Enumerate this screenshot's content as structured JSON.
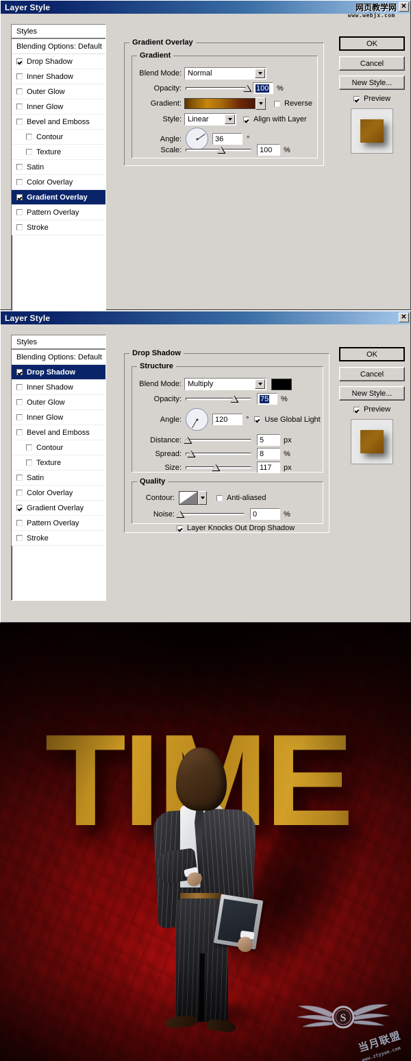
{
  "watermark_top": {
    "cn": "网页教学网",
    "url": "www.webjx.com"
  },
  "dialog1": {
    "title": "Layer Style",
    "close_label": "✕",
    "styles_panel": {
      "header": "Styles",
      "blending_options": "Blending Options: Default",
      "items": [
        {
          "label": "Drop Shadow",
          "checked": true,
          "indent": false,
          "selected": false
        },
        {
          "label": "Inner Shadow",
          "checked": false,
          "indent": false,
          "selected": false
        },
        {
          "label": "Outer Glow",
          "checked": false,
          "indent": false,
          "selected": false
        },
        {
          "label": "Inner Glow",
          "checked": false,
          "indent": false,
          "selected": false
        },
        {
          "label": "Bevel and Emboss",
          "checked": false,
          "indent": false,
          "selected": false
        },
        {
          "label": "Contour",
          "checked": false,
          "indent": true,
          "selected": false
        },
        {
          "label": "Texture",
          "checked": false,
          "indent": true,
          "selected": false
        },
        {
          "label": "Satin",
          "checked": false,
          "indent": false,
          "selected": false
        },
        {
          "label": "Color Overlay",
          "checked": false,
          "indent": false,
          "selected": false
        },
        {
          "label": "Gradient Overlay",
          "checked": true,
          "indent": false,
          "selected": true
        },
        {
          "label": "Pattern Overlay",
          "checked": false,
          "indent": false,
          "selected": false
        },
        {
          "label": "Stroke",
          "checked": false,
          "indent": false,
          "selected": false
        }
      ]
    },
    "panel": {
      "group_title": "Gradient Overlay",
      "section_title": "Gradient",
      "blend_mode_label": "Blend Mode:",
      "blend_mode_value": "Normal",
      "opacity_label": "Opacity:",
      "opacity_value": "100",
      "opacity_unit": "%",
      "gradient_label": "Gradient:",
      "reverse_label": "Reverse",
      "reverse_checked": false,
      "style_label": "Style:",
      "style_value": "Linear",
      "align_label": "Align with Layer",
      "align_checked": true,
      "angle_label": "Angle:",
      "angle_value": "36",
      "angle_unit": "°",
      "scale_label": "Scale:",
      "scale_value": "100",
      "scale_unit": "%"
    },
    "buttons": {
      "ok": "OK",
      "cancel": "Cancel",
      "new_style": "New Style...",
      "preview_label": "Preview",
      "preview_checked": true
    }
  },
  "dialog2": {
    "title": "Layer Style",
    "close_label": "✕",
    "styles_panel": {
      "header": "Styles",
      "blending_options": "Blending Options: Default",
      "items": [
        {
          "label": "Drop Shadow",
          "checked": true,
          "indent": false,
          "selected": true
        },
        {
          "label": "Inner Shadow",
          "checked": false,
          "indent": false,
          "selected": false
        },
        {
          "label": "Outer Glow",
          "checked": false,
          "indent": false,
          "selected": false
        },
        {
          "label": "Inner Glow",
          "checked": false,
          "indent": false,
          "selected": false
        },
        {
          "label": "Bevel and Emboss",
          "checked": false,
          "indent": false,
          "selected": false
        },
        {
          "label": "Contour",
          "checked": false,
          "indent": true,
          "selected": false
        },
        {
          "label": "Texture",
          "checked": false,
          "indent": true,
          "selected": false
        },
        {
          "label": "Satin",
          "checked": false,
          "indent": false,
          "selected": false
        },
        {
          "label": "Color Overlay",
          "checked": false,
          "indent": false,
          "selected": false
        },
        {
          "label": "Gradient Overlay",
          "checked": true,
          "indent": false,
          "selected": false
        },
        {
          "label": "Pattern Overlay",
          "checked": false,
          "indent": false,
          "selected": false
        },
        {
          "label": "Stroke",
          "checked": false,
          "indent": false,
          "selected": false
        }
      ]
    },
    "panel": {
      "group_title": "Drop Shadow",
      "structure_title": "Structure",
      "blend_mode_label": "Blend Mode:",
      "blend_mode_value": "Multiply",
      "shadow_color": "#000000",
      "opacity_label": "Opacity:",
      "opacity_value": "75",
      "opacity_unit": "%",
      "angle_label": "Angle:",
      "angle_value": "120",
      "angle_unit": "°",
      "global_light_label": "Use Global Light",
      "global_light_checked": true,
      "distance_label": "Distance:",
      "distance_value": "5",
      "distance_unit": "px",
      "spread_label": "Spread:",
      "spread_value": "8",
      "spread_unit": "%",
      "size_label": "Size:",
      "size_value": "117",
      "size_unit": "px",
      "quality_title": "Quality",
      "contour_label": "Contour:",
      "antialiased_label": "Anti-aliased",
      "antialiased_checked": false,
      "noise_label": "Noise:",
      "noise_value": "0",
      "noise_unit": "%",
      "knockout_label": "Layer Knocks Out Drop Shadow",
      "knockout_checked": true
    },
    "buttons": {
      "ok": "OK",
      "cancel": "Cancel",
      "new_style": "New Style...",
      "preview_label": "Preview",
      "preview_checked": true
    }
  },
  "poster": {
    "headline": "TIME",
    "headline_color": "#c79422",
    "background_color": "#8d0a0a",
    "logo_cn": "当月联盟",
    "logo_url": "www.ztyyue.com"
  }
}
